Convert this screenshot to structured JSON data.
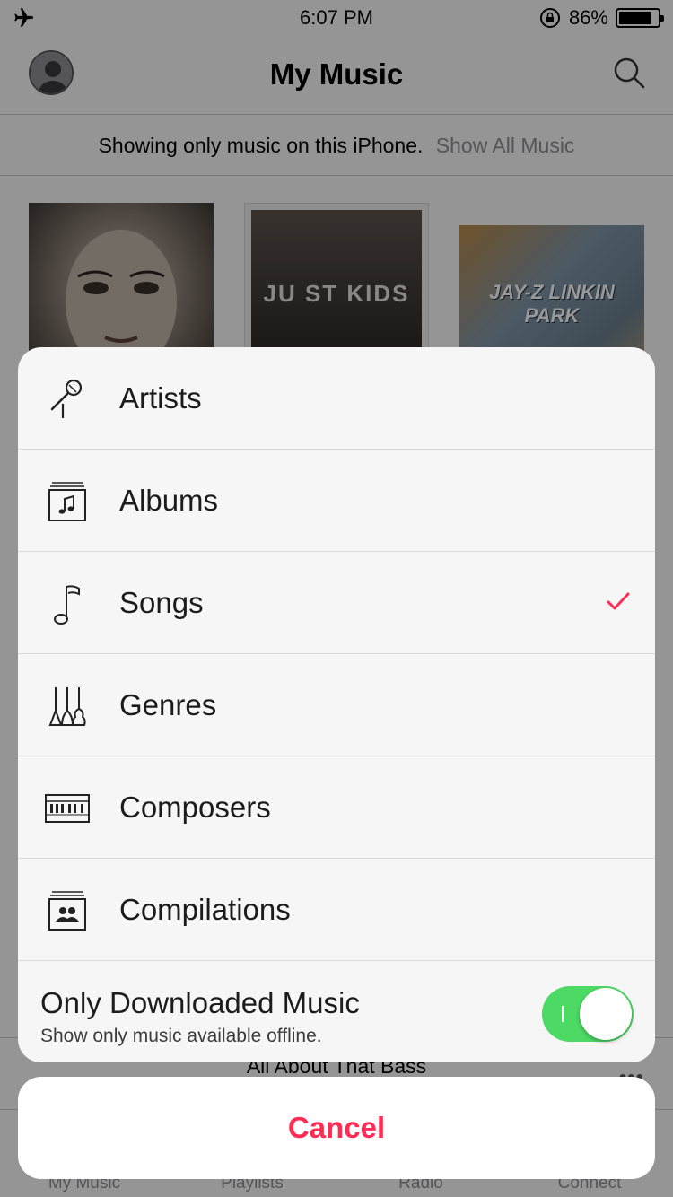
{
  "status_bar": {
    "time": "6:07 PM",
    "battery_percent": "86%",
    "battery_level": 0.86
  },
  "nav": {
    "title": "My Music"
  },
  "filter": {
    "text": "Showing only music on this iPhone.",
    "link": "Show All Music"
  },
  "albums": [
    {
      "art_text": ""
    },
    {
      "art_text": "JU ST  KIDS"
    },
    {
      "art_text": "JAY-Z LINKIN PARK"
    }
  ],
  "mini_player": {
    "title": "All About That Bass",
    "more_label": "•••"
  },
  "tabs": [
    {
      "label": "My Music"
    },
    {
      "label": "Playlists"
    },
    {
      "label": "Radio"
    },
    {
      "label": "Connect"
    }
  ],
  "menu": {
    "items": [
      {
        "label": "Artists",
        "icon": "microphone-icon",
        "selected": false
      },
      {
        "label": "Albums",
        "icon": "album-icon",
        "selected": false
      },
      {
        "label": "Songs",
        "icon": "music-note-icon",
        "selected": true
      },
      {
        "label": "Genres",
        "icon": "guitars-icon",
        "selected": false
      },
      {
        "label": "Composers",
        "icon": "piano-icon",
        "selected": false
      },
      {
        "label": "Compilations",
        "icon": "compilation-icon",
        "selected": false
      }
    ],
    "toggle": {
      "title": "Only Downloaded Music",
      "subtitle": "Show only music available offline.",
      "on": true
    },
    "cancel_label": "Cancel"
  },
  "colors": {
    "accent": "#ff2d55",
    "toggle_on": "#4cd964"
  }
}
